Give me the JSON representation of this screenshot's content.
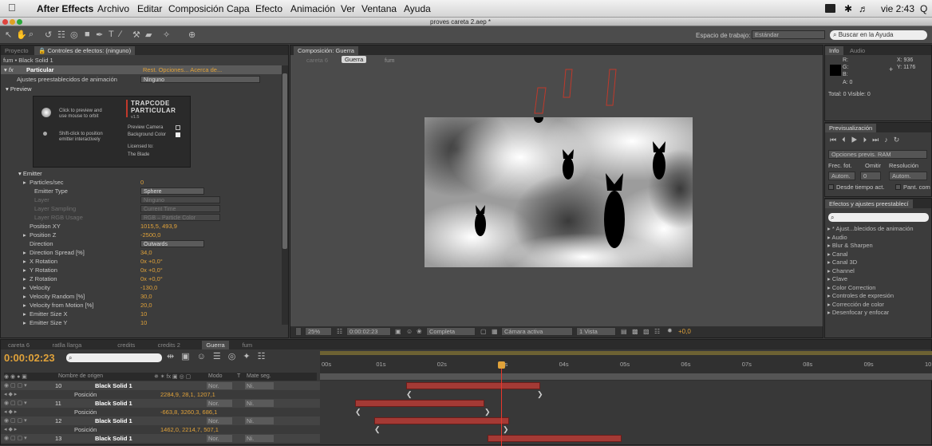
{
  "menubar": {
    "app": "After Effects",
    "items": [
      "Archivo",
      "Editar",
      "Composición",
      "Capa",
      "Efecto",
      "Animación",
      "Ver",
      "Ventana",
      "Ayuda"
    ],
    "clock": "vie 2:43",
    "search_glyph": "Q"
  },
  "window": {
    "title": "proves careta 2.aep *"
  },
  "toolbar": {
    "workspace_label": "Espacio de trabajo:",
    "workspace_value": "Estándar",
    "help_placeholder": "Buscar en la Ayuda"
  },
  "effects_panel": {
    "tabs": [
      "Proyecto",
      "Controles de efectos: (ninguno)"
    ],
    "breadcrumb": "fum • Black Solid 1",
    "effect_name": "Particular",
    "effect_links": "Rest.   Opciones...   Acerca de...",
    "presets_label": "Ajustes preestablecidos de animación",
    "presets_value": "Ninguno",
    "preview_label": "Preview",
    "preview": {
      "click_text_1": "Click to preview and",
      "click_text_2": "use mouse to orbit",
      "shift_text_1": "Shift-click to position",
      "shift_text_2": "emitter interactively",
      "brand_1": "TRAPCODE",
      "brand_2": "PARTICULAR",
      "version": "v1.5",
      "camera": "Preview Camera",
      "background": "Background Color",
      "licensed": "Licensed to:",
      "licensee": "The Blade"
    },
    "emitter_label": "Emitter",
    "rows": [
      {
        "label": "Particles/sec",
        "value": "0",
        "type": "value",
        "indent": 36,
        "arrow": true
      },
      {
        "label": "Emitter Type",
        "value": "Sphere",
        "type": "dropdown",
        "indent": 42
      },
      {
        "label": "Layer",
        "value": "Ninguno",
        "type": "dropdown-dim",
        "indent": 42
      },
      {
        "label": "Layer Sampling",
        "value": "Current Time",
        "type": "dropdown-dim",
        "indent": 42
      },
      {
        "label": "Layer RGB Usage",
        "value": "RGB – Particle Color",
        "type": "dropdown-dim",
        "indent": 42
      },
      {
        "label": "Position XY",
        "value": "1015,5, 493,9",
        "type": "value",
        "indent": 36
      },
      {
        "label": "Position Z",
        "value": "-2500,0",
        "type": "value",
        "indent": 36,
        "arrow": true
      },
      {
        "label": "Direction",
        "value": "Outwards",
        "type": "dropdown",
        "indent": 36
      },
      {
        "label": "Direction Spread [%]",
        "value": "34,0",
        "type": "value",
        "indent": 36,
        "arrow": true
      },
      {
        "label": "X Rotation",
        "value": "0x +0,0°",
        "type": "value",
        "indent": 36,
        "arrow": true
      },
      {
        "label": "Y Rotation",
        "value": "0x +0,0°",
        "type": "value",
        "indent": 36,
        "arrow": true
      },
      {
        "label": "Z Rotation",
        "value": "0x +0,0°",
        "type": "value",
        "indent": 36,
        "arrow": true
      },
      {
        "label": "Velocity",
        "value": "-130,0",
        "type": "value",
        "indent": 36,
        "arrow": true
      },
      {
        "label": "Velocity Random [%]",
        "value": "30,0",
        "type": "value",
        "indent": 36,
        "arrow": true
      },
      {
        "label": "Velocity from Motion [%]",
        "value": "20,0",
        "type": "value",
        "indent": 36,
        "arrow": true
      },
      {
        "label": "Emitter Size X",
        "value": "10",
        "type": "value",
        "indent": 36,
        "arrow": true
      },
      {
        "label": "Emitter Size Y",
        "value": "10",
        "type": "value",
        "indent": 36,
        "arrow": true
      }
    ]
  },
  "composition": {
    "tab": "Composición: Guerra",
    "crumbs": [
      "careta 6",
      "Guerra",
      "fum"
    ],
    "footer": {
      "zoom": "25%",
      "time": "0:00:02:23",
      "resolution": "Completa",
      "camera": "Cámara activa",
      "views": "1 Vista",
      "exposure": "+0,0"
    }
  },
  "info_panel": {
    "tabs": [
      "Info",
      "Audio"
    ],
    "r": "R:",
    "g": "G:",
    "b": "B:",
    "a": "A: 0",
    "x": "X: 936",
    "y": "Y: 1176",
    "total": "Total: 0  Visible: 0"
  },
  "preview_panel": {
    "tab": "Previsualización",
    "ram": "Opciones previs. RAM",
    "frec": "Frec. fot.",
    "omitir": "Omitir",
    "resolucion": "Resolución",
    "auto1": "Autom.",
    "zero": "0",
    "auto2": "Autom.",
    "desde": "Desde tiempo act.",
    "pant": "Pant. com"
  },
  "effects_presets": {
    "tab": "Efectos y ajustes preestablecí",
    "items": [
      "* Ajust...blecidos de animación",
      "Audio",
      "Blur & Sharpen",
      "Canal",
      "Canal 3D",
      "Channel",
      "Clave",
      "Color Correction",
      "Controles de expresión",
      "Corrección de color",
      "Desenfocar y enfocar"
    ]
  },
  "timeline": {
    "tabs": [
      "careta 6",
      "ratlla llarga",
      "credits",
      "credits 2",
      "Guerra",
      "fum"
    ],
    "active_tab": "Guerra",
    "timecode": "0:00:02:23",
    "header": {
      "source": "Nombre de origen",
      "mode": "Modo",
      "t": "T",
      "trkmat": "Mate seg."
    },
    "ruler": [
      "00s",
      "01s",
      "02s",
      "03s",
      "04s",
      "05s",
      "06s",
      "07s",
      "08s",
      "09s",
      "10"
    ],
    "layers": [
      {
        "num": "10",
        "name": "Black Solid 1",
        "mode": "Nor.",
        "mat": "Ni.",
        "is_layer": true
      },
      {
        "num": "",
        "name": "Posición",
        "value": "2284,9, 28,1, 1207,1",
        "is_layer": false
      },
      {
        "num": "11",
        "name": "Black Solid 1",
        "mode": "Nor.",
        "mat": "Ni.",
        "is_layer": true
      },
      {
        "num": "",
        "name": "Posición",
        "value": "-663,8, 3260,3, 686,1",
        "is_layer": false
      },
      {
        "num": "12",
        "name": "Black Solid 1",
        "mode": "Nor.",
        "mat": "Ni.",
        "is_layer": true
      },
      {
        "num": "",
        "name": "Posición",
        "value": "1462,0, 2214,7, 507,1",
        "is_layer": false
      },
      {
        "num": "13",
        "name": "Black Solid 1",
        "mode": "Nor.",
        "mat": "Ni.",
        "is_layer": true
      }
    ]
  },
  "colors": {
    "accent": "#e0a23a",
    "layer_bar": "#a43a35",
    "playhead": "#e8372b"
  }
}
